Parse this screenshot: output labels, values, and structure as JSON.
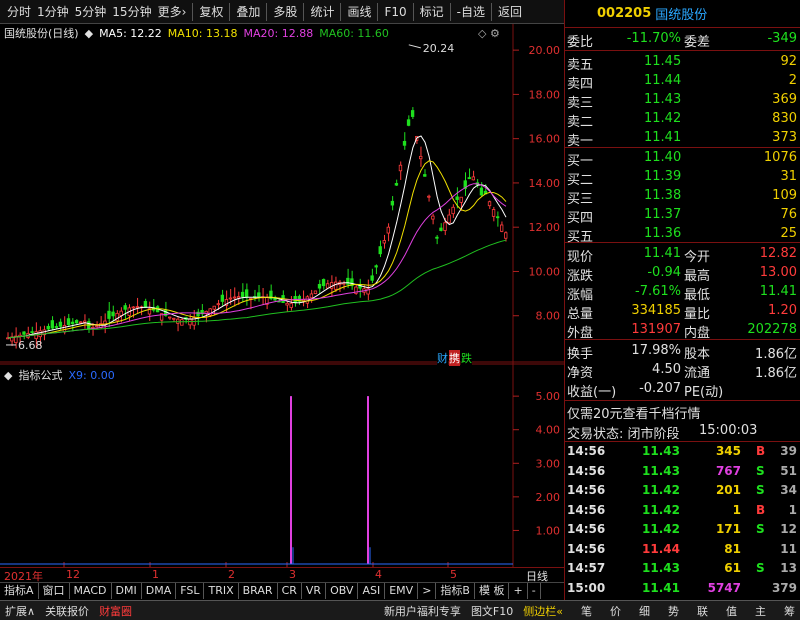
{
  "toolbar": {
    "items": [
      "分时",
      "1分钟",
      "5分钟",
      "15分钟",
      "更多›",
      "复权",
      "叠加",
      "多股",
      "统计",
      "画线",
      "F10",
      "标记",
      "-自选",
      "返回"
    ]
  },
  "stock": {
    "code": "002205",
    "name": "国统股份"
  },
  "chart": {
    "title": "国统股份(日线)",
    "ma5": "MA5: 12.22",
    "ma10": "MA10: 13.18",
    "ma20": "MA20: 12.88",
    "ma60": "MA60: 11.60",
    "high_label": "20.24",
    "low_label": "6.68",
    "yticks": [
      "20.00",
      "18.00",
      "16.00",
      "14.00",
      "12.00",
      "10.00",
      "8.00"
    ],
    "badges": [
      "财",
      "携",
      "跌"
    ]
  },
  "indicator": {
    "title": "指标公式",
    "sub": "X9: 0.00",
    "yticks": [
      "5.00",
      "4.00",
      "3.00",
      "2.00",
      "1.00"
    ]
  },
  "xaxis": {
    "labels": [
      "2021年",
      "12",
      "1",
      "2",
      "3",
      "4",
      "5"
    ],
    "period": "日线"
  },
  "tabs": [
    "指标A",
    "窗口",
    "MACD",
    "DMI",
    "DMA",
    "FSL",
    "TRIX",
    "BRAR",
    "CR",
    "VR",
    "OBV",
    "ASI",
    "EMV",
    ">",
    "指标B",
    "模 板",
    "+",
    "-"
  ],
  "bottom": {
    "left": [
      "扩展∧",
      "关联报价",
      "财富圈"
    ],
    "mid": [
      "新用户福利专享",
      "图文F10",
      "侧边栏«"
    ],
    "right": [
      "笔",
      "价",
      "细",
      "势",
      "联",
      "值",
      "主",
      "筹"
    ]
  },
  "quote": {
    "weibi": {
      "l1": "委比",
      "v1": "-11.70%",
      "l2": "委差",
      "v2": "-349"
    },
    "sells": [
      {
        "label": "卖五",
        "price": "11.45",
        "vol": "92"
      },
      {
        "label": "卖四",
        "price": "11.44",
        "vol": "2"
      },
      {
        "label": "卖三",
        "price": "11.43",
        "vol": "369"
      },
      {
        "label": "卖二",
        "price": "11.42",
        "vol": "830"
      },
      {
        "label": "卖一",
        "price": "11.41",
        "vol": "373"
      }
    ],
    "buys": [
      {
        "label": "买一",
        "price": "11.40",
        "vol": "1076"
      },
      {
        "label": "买二",
        "price": "11.39",
        "vol": "31"
      },
      {
        "label": "买三",
        "price": "11.38",
        "vol": "109"
      },
      {
        "label": "买四",
        "price": "11.37",
        "vol": "76"
      },
      {
        "label": "买五",
        "price": "11.36",
        "vol": "25"
      }
    ],
    "stats": [
      {
        "l1": "现价",
        "v1": "11.41",
        "l2": "今开",
        "v2": "12.82"
      },
      {
        "l1": "涨跌",
        "v1": "-0.94",
        "l2": "最高",
        "v2": "13.00"
      },
      {
        "l1": "涨幅",
        "v1": "-7.61%",
        "l2": "最低",
        "v2": "11.41"
      },
      {
        "l1": "总量",
        "v1": "334185",
        "l2": "量比",
        "v2": "1.20"
      },
      {
        "l1": "外盘",
        "v1": "131907",
        "l2": "内盘",
        "v2": "202278"
      }
    ],
    "stats2": [
      {
        "l1": "换手",
        "v1": "17.98%",
        "l2": "股本",
        "v2": "1.86亿"
      },
      {
        "l1": "净资",
        "v1": "4.50",
        "l2": "流通",
        "v2": "1.86亿"
      },
      {
        "l1": "收益(一)",
        "v1": "-0.207",
        "l2": "PE(动)",
        "v2": ""
      }
    ],
    "promo": "仅需20元查看千档行情",
    "status": {
      "label": "交易状态: 闭市阶段",
      "time": "15:00:03"
    },
    "ticks": [
      {
        "t": "14:56",
        "p": "11.43",
        "v": "345",
        "d": "B",
        "n": "39"
      },
      {
        "t": "14:56",
        "p": "11.43",
        "v": "767",
        "d": "S",
        "n": "51"
      },
      {
        "t": "14:56",
        "p": "11.42",
        "v": "201",
        "d": "S",
        "n": "34"
      },
      {
        "t": "14:56",
        "p": "11.42",
        "v": "1",
        "d": "B",
        "n": "1"
      },
      {
        "t": "14:56",
        "p": "11.42",
        "v": "171",
        "d": "S",
        "n": "12"
      },
      {
        "t": "14:56",
        "p": "11.44",
        "v": "81",
        "d": "",
        "n": "11"
      },
      {
        "t": "14:57",
        "p": "11.43",
        "v": "61",
        "d": "S",
        "n": "13"
      },
      {
        "t": "15:00",
        "p": "11.41",
        "v": "5747",
        "d": "",
        "n": "379"
      }
    ]
  },
  "colors": {
    "up": "#ff3b3b",
    "down": "#1ee01e",
    "ma5": "#ffffff",
    "ma10": "#f0e000",
    "ma20": "#e040e0",
    "ma60": "#20c020"
  }
}
